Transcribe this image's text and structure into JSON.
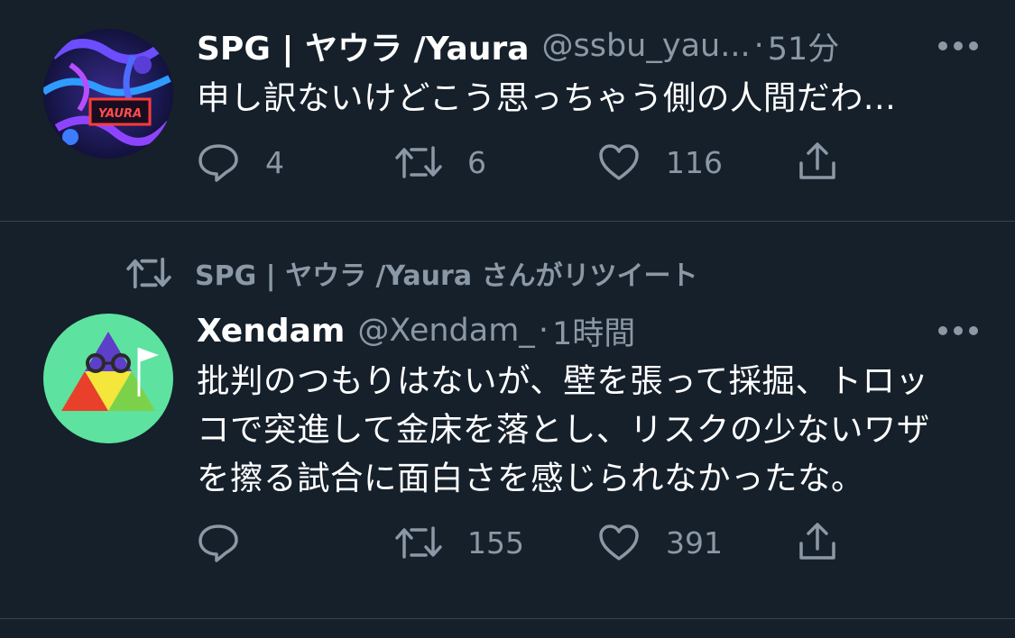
{
  "tweets": [
    {
      "display_name": "SPG | ヤウラ /Yaura",
      "handle": "@ssbu_yau...",
      "separator": "·",
      "time": "51分",
      "text": "申し訳ないけどこう思っちゃう側の人間だわ...",
      "avatar_label": "YAURA",
      "reply_count": "4",
      "retweet_count": "6",
      "like_count": "116"
    },
    {
      "retweet_banner": "SPG | ヤウラ /Yaura さんがリツイート",
      "display_name": "Xendam",
      "handle": "@Xendam_",
      "separator": "·",
      "time": "1時間",
      "text": "批判のつもりはないが、壁を張って採掘、トロッコで突進して金床を落とし、リスクの少ないワザを擦る試合に面白さを感じられなかったな。",
      "reply_count": "",
      "retweet_count": "155",
      "like_count": "391"
    }
  ],
  "icons": {
    "more": "more-horizontal-icon",
    "reply": "reply-icon",
    "retweet": "retweet-icon",
    "like": "heart-icon",
    "share": "share-icon"
  },
  "colors": {
    "background": "#15202b",
    "secondary_text": "#8b98a5",
    "divider": "#38444d",
    "primary_text": "#ffffff"
  }
}
